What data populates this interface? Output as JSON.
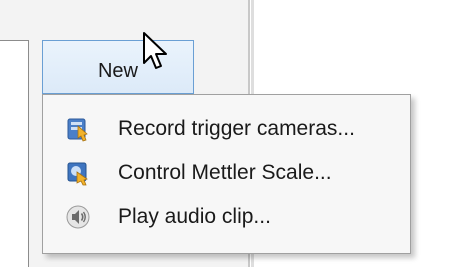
{
  "toolbar": {
    "new_label": "New"
  },
  "menu": {
    "items": [
      {
        "label": "Record trigger cameras...",
        "icon": "record-camera-icon"
      },
      {
        "label": "Control Mettler Scale...",
        "icon": "scale-control-icon"
      },
      {
        "label": "Play audio clip...",
        "icon": "speaker-icon"
      }
    ]
  },
  "colors": {
    "button_border": "#6a9fd4",
    "button_fill": "#dceaf8",
    "menu_bg": "#f7f7f7",
    "panel_bg": "#f3f3f3"
  }
}
